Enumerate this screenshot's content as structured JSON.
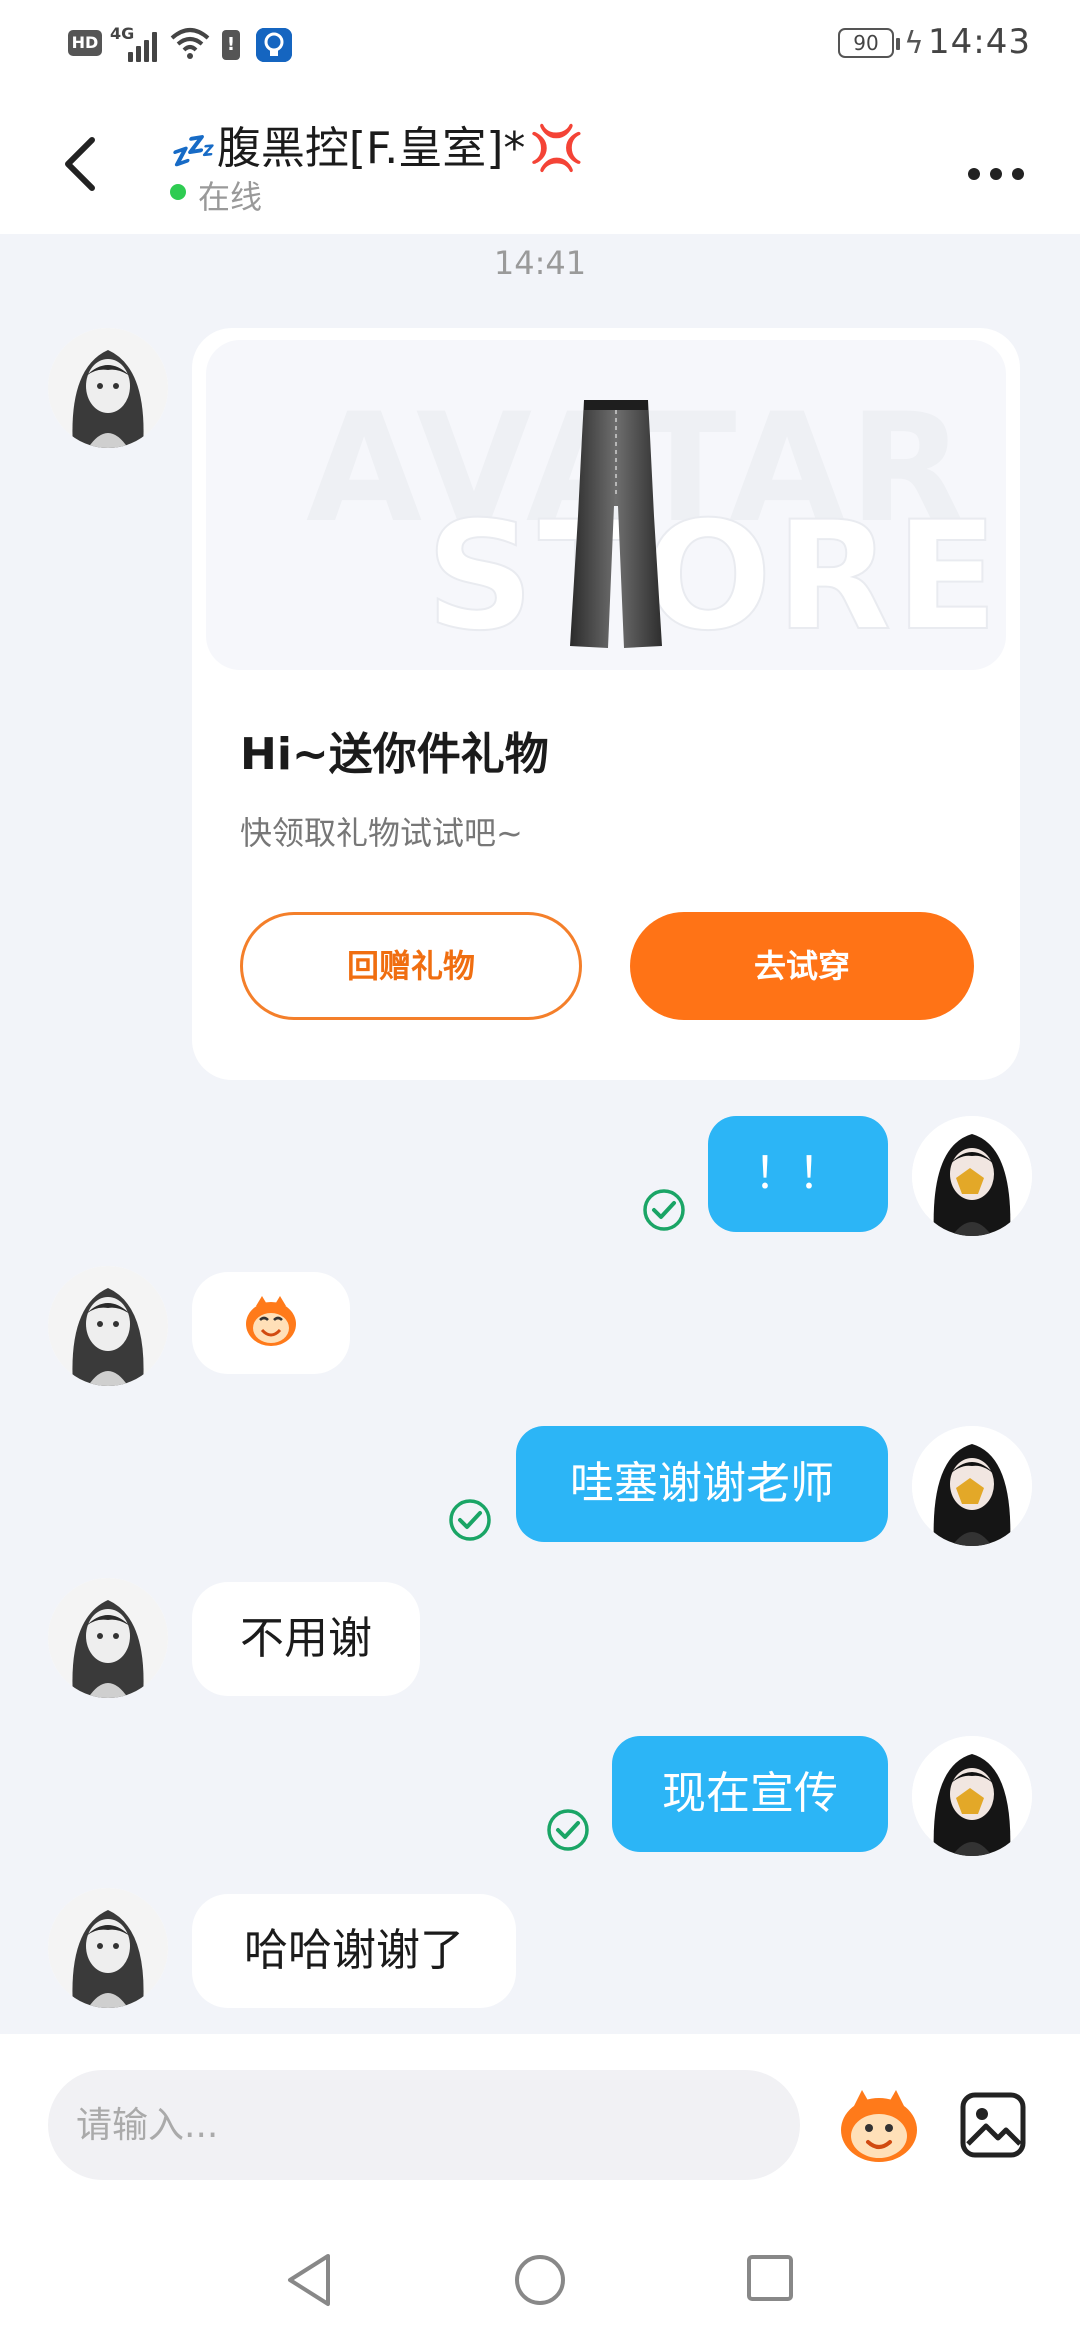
{
  "status_bar": {
    "hd_label": "HD",
    "network_label": "4G",
    "battery_level": "90",
    "time": "14:43"
  },
  "header": {
    "contact_name": "腹黑控[F.皇室]*",
    "name_prefix_emoji": "💤",
    "name_suffix_emoji": "💢",
    "status": "在线",
    "back_icon": "chevron-left-icon",
    "more_icon": "more-horizontal-icon"
  },
  "conversation": {
    "time_divider": "14:41",
    "gift_card": {
      "title": "Hi~送你件礼物",
      "subtitle": "快领取礼物试试吧~",
      "image_watermark_line1": "AVATAR",
      "image_watermark_line2": "STORE",
      "return_gift_button": "回赠礼物",
      "try_on_button": "去试穿"
    },
    "messages": [
      {
        "from": "me",
        "text": "！！",
        "read": true
      },
      {
        "from": "contact",
        "text": "",
        "sticker": "monkey-face-emoji"
      },
      {
        "from": "me",
        "text": "哇塞谢谢老师",
        "read": true
      },
      {
        "from": "contact",
        "text": "不用谢"
      },
      {
        "from": "me",
        "text": "现在宣传",
        "read": true
      },
      {
        "from": "contact",
        "text": "哈哈谢谢了"
      }
    ]
  },
  "input_bar": {
    "placeholder": "请输入...",
    "value": "",
    "emoji_icon": "monkey-emoji-icon",
    "image_icon": "image-icon"
  },
  "colors": {
    "outgoing_bubble": "#2cb5f6",
    "accent_orange": "#ff7316",
    "online_green": "#2ecc52",
    "read_check_green": "#1aa566",
    "background": "#f2f4f9"
  }
}
